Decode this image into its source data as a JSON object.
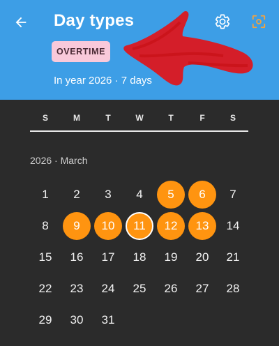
{
  "header": {
    "title": "Day types",
    "chip_label": "OVERTIME",
    "subtitle": "In year 2026 · 7 days",
    "icons": {
      "back": "arrow-left-icon",
      "settings": "gear-icon",
      "scan": "scan-focus-icon"
    },
    "colors": {
      "header_bg": "#3d9ee6",
      "chip_bg": "#f9c9da",
      "scan_icon": "#f5a23c",
      "scribble": "#e0141a"
    }
  },
  "calendar": {
    "weekdays": [
      "S",
      "M",
      "T",
      "W",
      "T",
      "F",
      "S"
    ],
    "month_label": "2026 · March",
    "weeks": [
      [
        {
          "day": "1"
        },
        {
          "day": "2"
        },
        {
          "day": "3"
        },
        {
          "day": "4"
        },
        {
          "day": "5",
          "selected": true
        },
        {
          "day": "6",
          "selected": true
        },
        {
          "day": "7"
        }
      ],
      [
        {
          "day": "8"
        },
        {
          "day": "9",
          "selected": true
        },
        {
          "day": "10",
          "selected": true
        },
        {
          "day": "11",
          "selected": true,
          "today": true
        },
        {
          "day": "12",
          "selected": true
        },
        {
          "day": "13",
          "selected": true
        },
        {
          "day": "14"
        }
      ],
      [
        {
          "day": "15"
        },
        {
          "day": "16"
        },
        {
          "day": "17"
        },
        {
          "day": "18"
        },
        {
          "day": "19"
        },
        {
          "day": "20"
        },
        {
          "day": "21"
        }
      ],
      [
        {
          "day": "22"
        },
        {
          "day": "23"
        },
        {
          "day": "24"
        },
        {
          "day": "25"
        },
        {
          "day": "26"
        },
        {
          "day": "27"
        },
        {
          "day": "28"
        }
      ],
      [
        {
          "day": "29"
        },
        {
          "day": "30"
        },
        {
          "day": "31"
        }
      ]
    ],
    "colors": {
      "selected": "#ff9410",
      "background": "#2b2b2b"
    }
  }
}
